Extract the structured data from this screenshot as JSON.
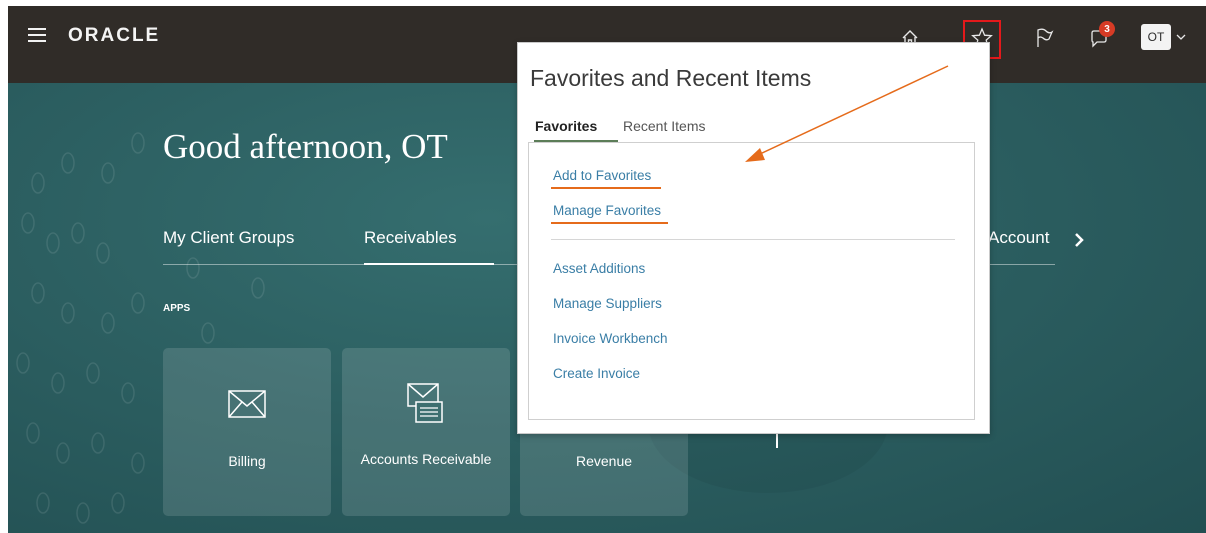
{
  "header": {
    "logo": "ORACLE",
    "icons": [
      "menu-icon",
      "home-icon",
      "star-icon",
      "flag-icon",
      "notifications-icon"
    ],
    "notification_count": "3",
    "user_initials": "OT"
  },
  "main": {
    "greeting": "Good afternoon, OT",
    "nav_tabs": [
      {
        "label": "My Client Groups"
      },
      {
        "label": "Receivables"
      },
      {
        "label": "Account"
      }
    ],
    "apps_label": "APPS",
    "tiles": [
      {
        "label": "Billing",
        "icon": "envelope-icon"
      },
      {
        "label": "Accounts Receivable",
        "icon": "invoice-icon"
      },
      {
        "label": "Revenue",
        "icon": ""
      }
    ]
  },
  "popup": {
    "title": "Favorites and Recent Items",
    "tabs": [
      {
        "label": "Favorites",
        "active": true
      },
      {
        "label": "Recent Items",
        "active": false
      }
    ],
    "actions": [
      "Add to Favorites",
      "Manage Favorites"
    ],
    "favorites": [
      "Asset Additions",
      "Manage Suppliers",
      "Invoice Workbench",
      "Create Invoice"
    ]
  },
  "colors": {
    "topbar": "#302c28",
    "teal": "#2c5f61",
    "link": "#3a7ea6",
    "highlight_box": "#e4191b",
    "annotation_orange": "#e56b1b",
    "badge": "#d63b25"
  }
}
